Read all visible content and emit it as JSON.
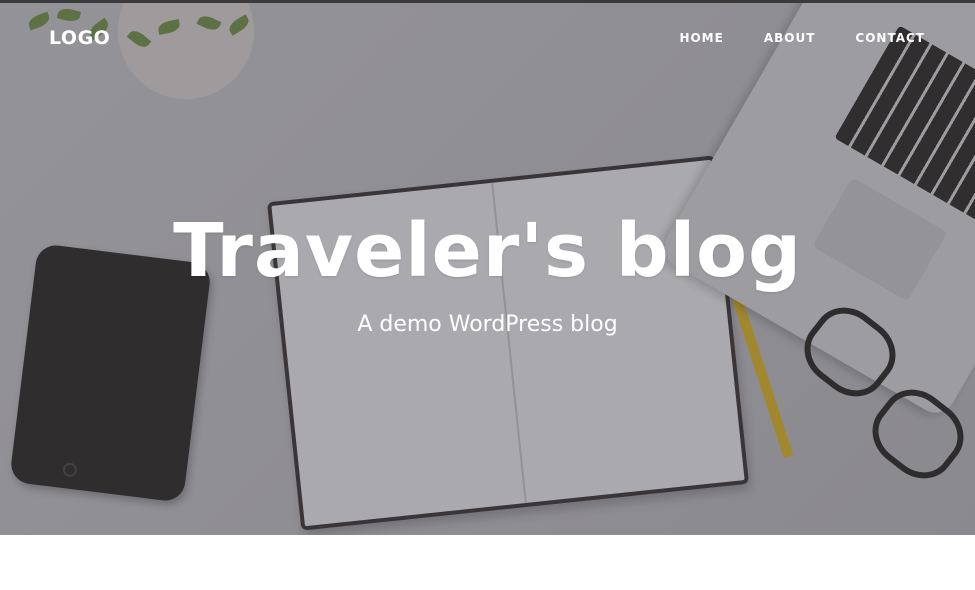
{
  "header": {
    "logo": "LOGO",
    "nav": [
      {
        "label": "HOME"
      },
      {
        "label": "ABOUT"
      },
      {
        "label": "CONTACT"
      }
    ]
  },
  "hero": {
    "title": "Traveler's blog",
    "subtitle": "A demo WordPress blog"
  }
}
